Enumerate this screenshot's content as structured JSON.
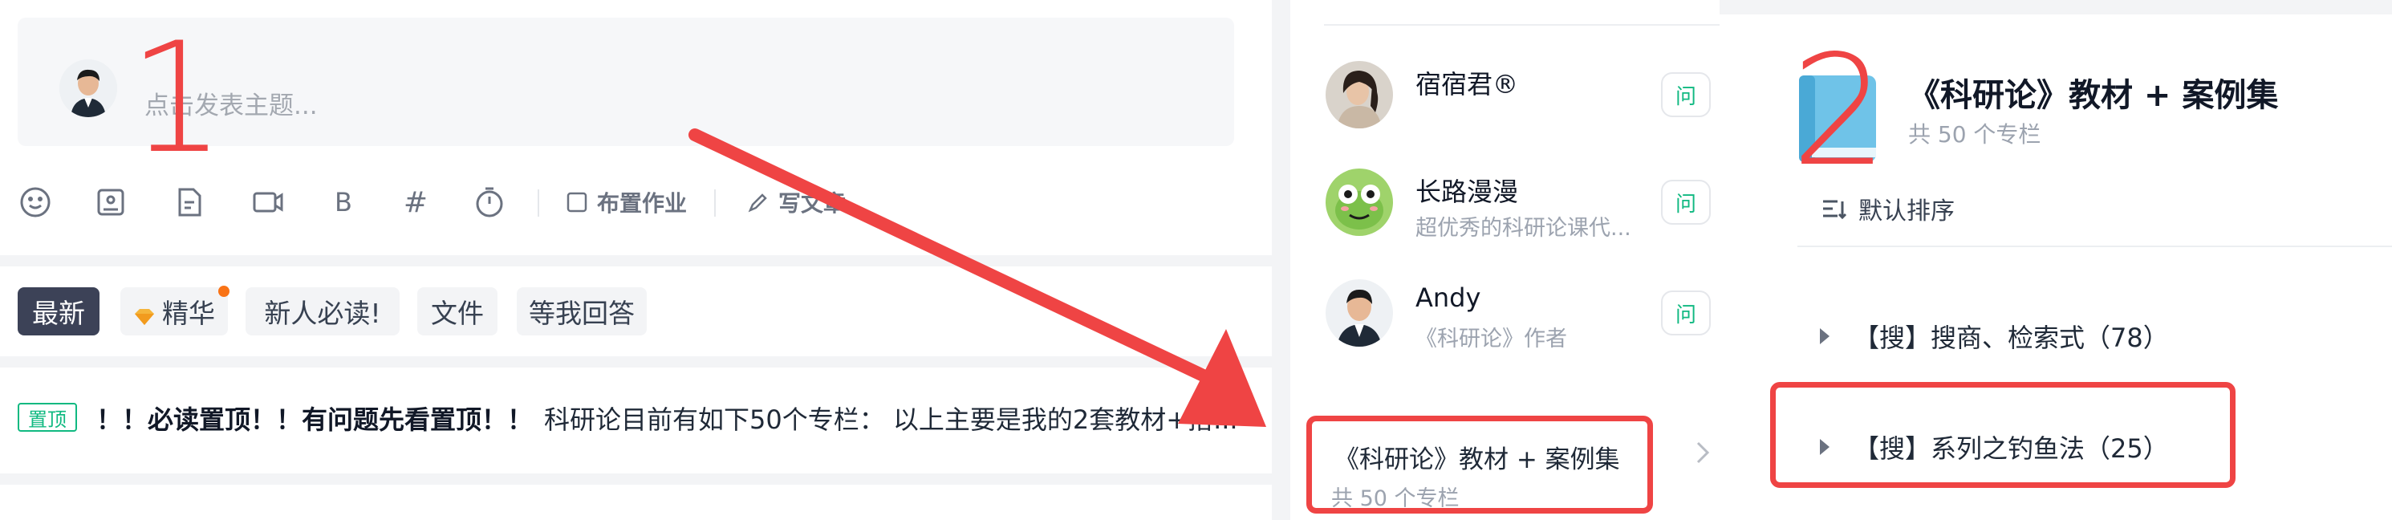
{
  "composer": {
    "placeholder": "点击发表主题...",
    "marker": "1"
  },
  "toolbar": {
    "icons": [
      "emoji-icon",
      "image-icon",
      "document-icon",
      "video-icon",
      "bold-icon",
      "hashtag-icon",
      "timer-icon"
    ],
    "bold_glyph": "B",
    "hashtag_glyph": "#",
    "assign_homework": "布置作业",
    "write_article": "写文章"
  },
  "tabs": [
    {
      "label": "最新",
      "active": true
    },
    {
      "label": "精华",
      "active": false,
      "dot": true
    },
    {
      "label": "新人必读!",
      "active": false
    },
    {
      "label": "文件",
      "active": false
    },
    {
      "label": "等我回答",
      "active": false
    }
  ],
  "pinned": {
    "badge": "置顶",
    "title": "！！必读置顶！！有问题先看置顶！！",
    "body": "科研论目前有如下50个专栏：   以上主要是我的2套教材+搭..."
  },
  "users": [
    {
      "name": "宿宿君®",
      "sub": "",
      "ask": "问"
    },
    {
      "name": "长路漫漫",
      "sub": "超优秀的科研论课代...",
      "ask": "问"
    },
    {
      "name": "Andy",
      "sub": "《科研论》作者",
      "ask": "问"
    }
  ],
  "column_link": {
    "title": "《科研论》教材 + 案例集",
    "subtitle": "共 50 个专栏"
  },
  "column_panel": {
    "marker": "2",
    "title": "《科研论》教材 + 案例集",
    "subtitle": "共 50 个专栏",
    "sort_label": "默认排序",
    "items": [
      {
        "label": "【搜】搜商、检索式（78）"
      },
      {
        "label": "【搜】系列之钓鱼法（25）"
      }
    ]
  },
  "colors": {
    "accent_red": "#ef4444",
    "active_tab": "#3c4257",
    "green": "#10b981"
  }
}
